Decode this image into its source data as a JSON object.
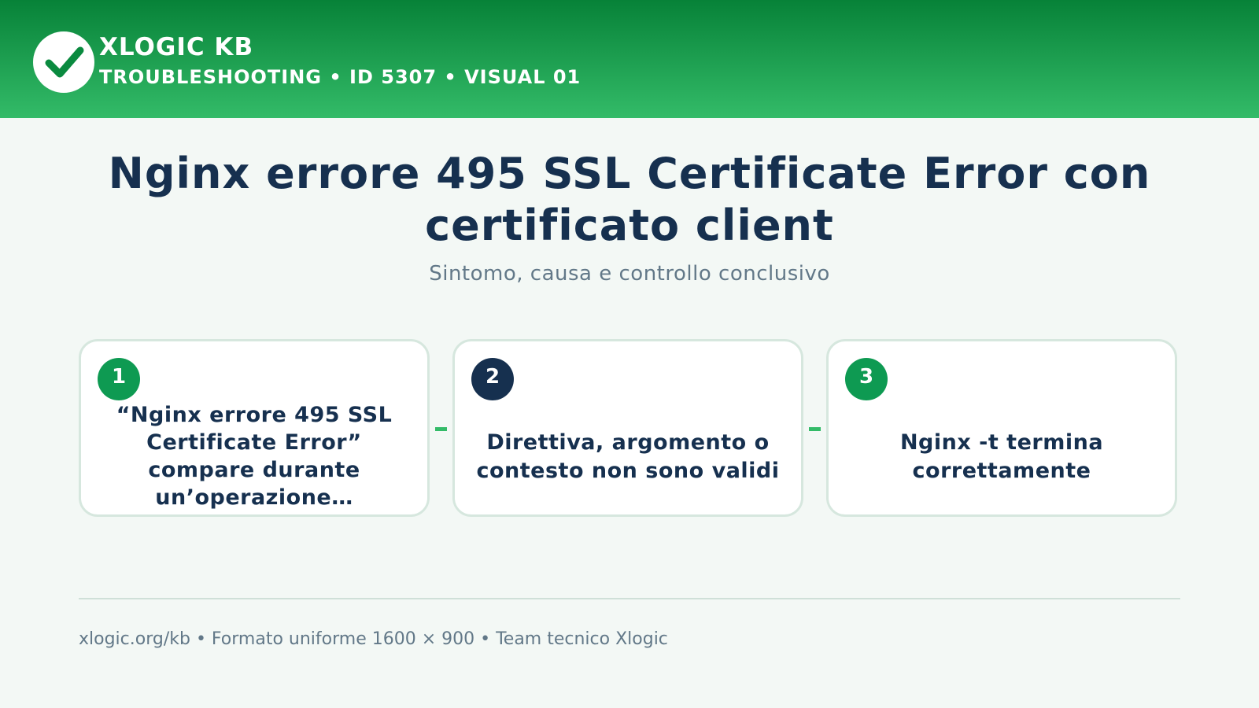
{
  "header": {
    "logo_icon": "check-icon",
    "brand_name": "XLOGIC KB",
    "meta": "TROUBLESHOOTING • ID 5307 • VISUAL 01",
    "gradient_top": "#078238",
    "gradient_bottom": "#33bb68"
  },
  "main": {
    "title": "Nginx errore 495 SSL Certificate Error con certificato client",
    "subtitle": "Sintomo, causa e controllo conclusivo"
  },
  "steps": [
    {
      "number": "1",
      "text": "“Nginx errore 495 SSL Certificate Error” compare durante un’operazione…",
      "badge_color": "#0e9a52"
    },
    {
      "number": "2",
      "text": "Direttiva, argomento o contesto non sono validi",
      "badge_color": "#16304f"
    },
    {
      "number": "3",
      "text": "Nginx -t termina correttamente",
      "badge_color": "#0e9a52"
    }
  ],
  "footer": {
    "text": "xlogic.org/kb • Formato uniforme 1600 × 900 • Team tecnico Xlogic"
  }
}
